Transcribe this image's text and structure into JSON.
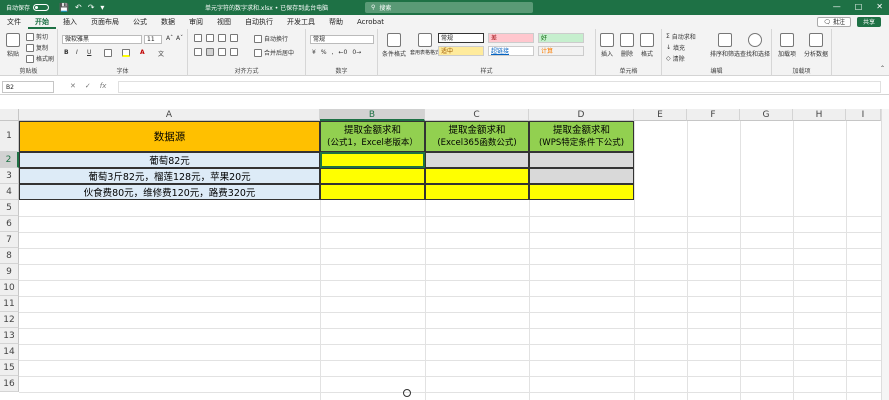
{
  "titlebar": {
    "autosave_label": "自动保存",
    "doc_title": "单元字符的数字求和.xlsx • 已保存到此台电脑",
    "search_placeholder": "搜索"
  },
  "tabs": [
    "文件",
    "开始",
    "插入",
    "页面布局",
    "公式",
    "数据",
    "审阅",
    "视图",
    "自动执行",
    "开发工具",
    "帮助",
    "Acrobat"
  ],
  "active_tab": "开始",
  "ribbon_buttons": {
    "comment": "批注",
    "share": "共享"
  },
  "ribbon": {
    "clipboard": {
      "paste": "粘贴",
      "cut": "剪切",
      "copy": "复制",
      "format_painter": "格式刷",
      "label": "剪贴板"
    },
    "font": {
      "font_name": "微软雅黑",
      "font_size": "11",
      "bold": "B",
      "italic": "I",
      "underline": "U",
      "label": "字体"
    },
    "alignment": {
      "wrap": "自动换行",
      "merge": "合并后居中",
      "label": "对齐方式"
    },
    "number": {
      "format": "常规",
      "label": "数字"
    },
    "styles": {
      "conditional": "条件格式",
      "table": "套用表格格式",
      "cells": [
        "常规",
        "差",
        "好",
        "适中",
        "超链接",
        "计算"
      ],
      "label": "样式"
    },
    "cells_group": {
      "insert": "插入",
      "delete": "删除",
      "format": "格式",
      "label": "单元格"
    },
    "editing": {
      "autosum": "自动求和",
      "fill": "填充",
      "clear": "清除",
      "sort": "排序和筛选",
      "find": "查找和选择",
      "label": "编辑"
    },
    "addins": {
      "addins": "加载项",
      "analyze": "分析数据",
      "label": "加载项"
    }
  },
  "formula_bar": {
    "name_box": "B2",
    "formula": ""
  },
  "columns": [
    "A",
    "B",
    "C",
    "D",
    "E",
    "F",
    "G",
    "H",
    "I"
  ],
  "rows": [
    "1",
    "2",
    "3",
    "4",
    "5",
    "6",
    "7",
    "8",
    "9",
    "10",
    "11",
    "12",
    "13",
    "14",
    "15",
    "16"
  ],
  "selected_cell": "B2",
  "sheet": {
    "A1": "数据源",
    "B1_title": "提取金额求和",
    "B1_sub": "(公式1，Excel老版本）",
    "C1_title": "提取金额求和",
    "C1_sub": "(Excel365函数公式)",
    "D1_title": "提取金额求和",
    "D1_sub": "(WPS特定条件下公式)",
    "A2": "葡萄82元",
    "A3": "葡萄3斤82元，榴莲128元，苹果20元",
    "A4": "伙食费80元，维修费120元，路费320元"
  },
  "colors": {
    "header_orange": "#FFC000",
    "header_green": "#92D050",
    "data_blue": "#DDEBF7",
    "fill_yellow": "#FFFF00",
    "fill_gray": "#D9D9D9",
    "excel_green": "#1E7145"
  }
}
